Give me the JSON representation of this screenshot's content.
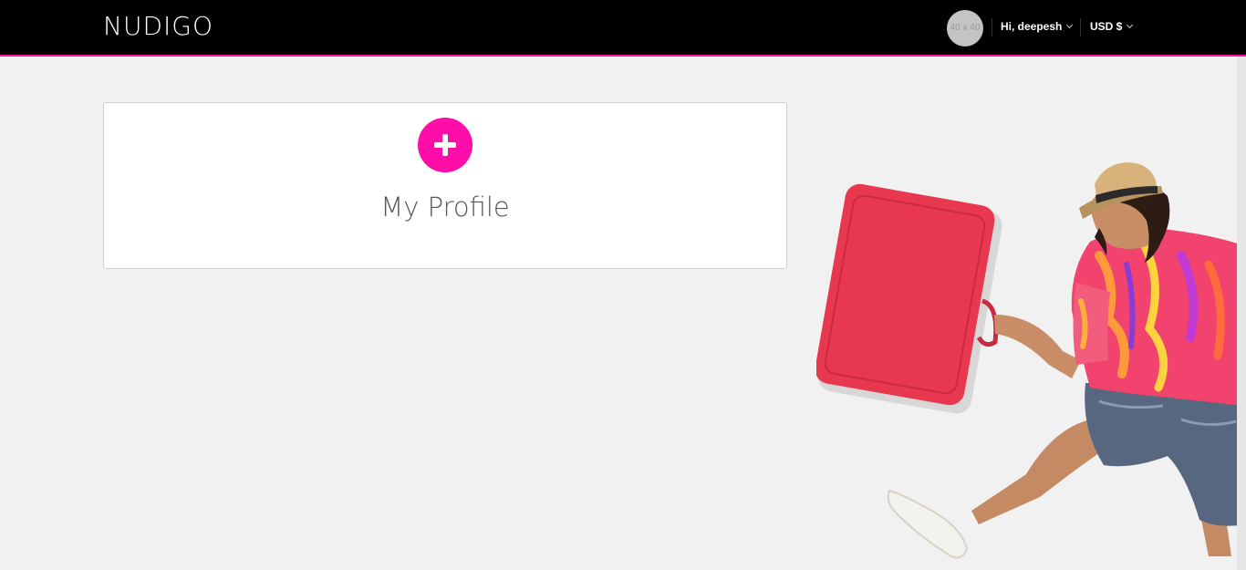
{
  "header": {
    "logo": "NUDIGO",
    "avatar_placeholder": "40 x 40",
    "user_menu_label": "Hi, deepesh",
    "currency_label": "USD $"
  },
  "main": {
    "profile_card_title": "My Profile"
  },
  "colors": {
    "accent": "#ff0da7",
    "topbar": "#000000",
    "page_background": "#f1f1f1"
  },
  "icons": {
    "add": "plus-icon",
    "dropdown": "chevron-down-icon"
  }
}
